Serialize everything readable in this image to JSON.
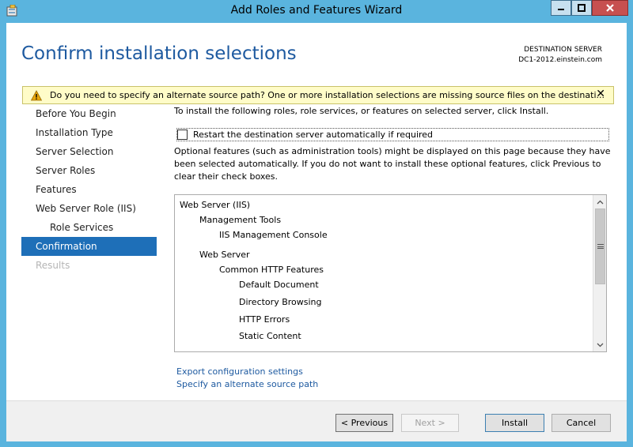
{
  "window": {
    "title": "Add Roles and Features Wizard",
    "buttons": {
      "minimize": "minimize",
      "maximize": "maximize",
      "close": "close"
    }
  },
  "header": {
    "page_title": "Confirm installation selections",
    "destination_label": "DESTINATION SERVER",
    "destination_server": "DC1-2012.einstein.com"
  },
  "warning": {
    "text": "Do you need to specify an alternate source path? One or more installation selections are missing source files on the destinati...",
    "close_glyph": "✕",
    "icon": "warning-icon"
  },
  "nav": {
    "items": [
      {
        "label": "Before You Begin",
        "state": "normal"
      },
      {
        "label": "Installation Type",
        "state": "normal"
      },
      {
        "label": "Server Selection",
        "state": "normal"
      },
      {
        "label": "Server Roles",
        "state": "normal"
      },
      {
        "label": "Features",
        "state": "normal"
      },
      {
        "label": "Web Server Role (IIS)",
        "state": "normal"
      },
      {
        "label": "Role Services",
        "state": "sub"
      },
      {
        "label": "Confirmation",
        "state": "active"
      },
      {
        "label": "Results",
        "state": "disabled"
      }
    ]
  },
  "main": {
    "intro": "To install the following roles, role services, or features on selected server, click Install.",
    "restart_label": "Restart the destination server automatically if required",
    "restart_checked": false,
    "optional_text": "Optional features (such as administration tools) might be displayed on this page because they have been selected automatically. If you do not want to install these optional features, click Previous to clear their check boxes.",
    "selections": [
      {
        "label": "Web Server (IIS)",
        "level": 0
      },
      {
        "label": "Management Tools",
        "level": 1
      },
      {
        "label": "IIS Management Console",
        "level": 2
      },
      {
        "label": "Web Server",
        "level": 1
      },
      {
        "label": "Common HTTP Features",
        "level": 2
      },
      {
        "label": "Default Document",
        "level": 3
      },
      {
        "label": "Directory Browsing",
        "level": 3
      },
      {
        "label": "HTTP Errors",
        "level": 3
      },
      {
        "label": "Static Content",
        "level": 3
      }
    ],
    "links": {
      "export": "Export configuration settings",
      "alternate_source": "Specify an alternate source path"
    }
  },
  "footer": {
    "previous": "< Previous",
    "next": "Next >",
    "install": "Install",
    "cancel": "Cancel"
  },
  "colors": {
    "title_bar": "#5ab4de",
    "page_title": "#1e5aa0",
    "nav_active": "#1e6fb8",
    "warning_bg": "#fffcc8",
    "link": "#1e5aa0"
  }
}
